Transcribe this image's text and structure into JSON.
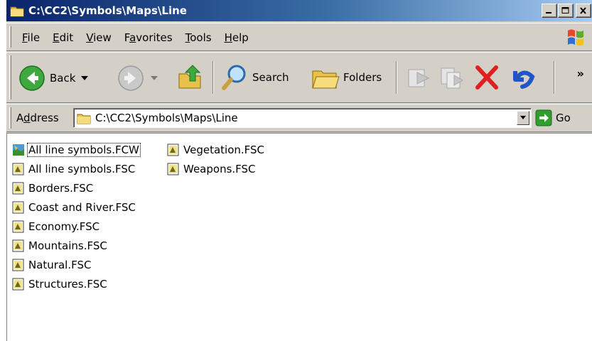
{
  "window": {
    "title": "C:\\CC2\\Symbols\\Maps\\Line"
  },
  "menu": [
    {
      "label": "File",
      "accel": "F",
      "rest": "ile"
    },
    {
      "label": "Edit",
      "accel": "E",
      "rest": "dit"
    },
    {
      "label": "View",
      "accel": "V",
      "rest": "iew"
    },
    {
      "label": "Favorites",
      "accel": "a",
      "pre": "F",
      "rest": "vorites"
    },
    {
      "label": "Tools",
      "accel": "T",
      "rest": "ools"
    },
    {
      "label": "Help",
      "accel": "H",
      "rest": "elp"
    }
  ],
  "toolbar": {
    "back_label": "Back",
    "search_label": "Search",
    "folders_label": "Folders",
    "overflow": "»"
  },
  "address": {
    "label_accel": "d",
    "label_pre": "A",
    "label_rest": "dress",
    "value": "C:\\CC2\\Symbols\\Maps\\Line",
    "go_label": "Go"
  },
  "files": [
    {
      "name": "All line symbols.FCW",
      "type": "fcw",
      "selected": true
    },
    {
      "name": "All line symbols.FSC",
      "type": "fsc"
    },
    {
      "name": "Borders.FSC",
      "type": "fsc"
    },
    {
      "name": "Coast and River.FSC",
      "type": "fsc"
    },
    {
      "name": "Economy.FSC",
      "type": "fsc"
    },
    {
      "name": "Mountains.FSC",
      "type": "fsc"
    },
    {
      "name": "Natural.FSC",
      "type": "fsc"
    },
    {
      "name": "Structures.FSC",
      "type": "fsc"
    },
    {
      "name": "Vegetation.FSC",
      "type": "fsc"
    },
    {
      "name": "Weapons.FSC",
      "type": "fsc"
    }
  ],
  "colors": {
    "title_bar_start": "#0a246a",
    "title_bar_end": "#a6caf0",
    "chrome": "#d4d0c8",
    "close_red": "#e02020",
    "go_green": "#2e9e2e"
  }
}
